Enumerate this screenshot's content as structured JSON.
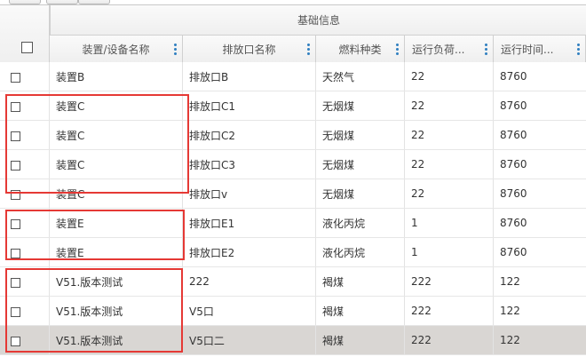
{
  "header": {
    "group_title": "基础信息",
    "columns": [
      "装置/设备名称",
      "排放口名称",
      "燃料种类",
      "运行负荷...",
      "运行时间..."
    ]
  },
  "rows": [
    {
      "device": "装置B",
      "outlet": "排放口B",
      "fuel": "天然气",
      "load": "22",
      "hours": "8760"
    },
    {
      "device": "装置C",
      "outlet": "排放口C1",
      "fuel": "无烟煤",
      "load": "22",
      "hours": "8760"
    },
    {
      "device": "装置C",
      "outlet": "排放口C2",
      "fuel": "无烟煤",
      "load": "22",
      "hours": "8760"
    },
    {
      "device": "装置C",
      "outlet": "排放口C3",
      "fuel": "无烟煤",
      "load": "22",
      "hours": "8760"
    },
    {
      "device": "装置C",
      "outlet": "排放口v",
      "fuel": "无烟煤",
      "load": "22",
      "hours": "8760"
    },
    {
      "device": "装置E",
      "outlet": "排放口E1",
      "fuel": "液化丙烷",
      "load": "1",
      "hours": "8760"
    },
    {
      "device": "装置E",
      "outlet": "排放口E2",
      "fuel": "液化丙烷",
      "load": "1",
      "hours": "8760"
    },
    {
      "device": "V51.版本测试",
      "outlet": "222",
      "fuel": "褐煤",
      "load": "222",
      "hours": "122"
    },
    {
      "device": "V51.版本测试",
      "outlet": "V5口",
      "fuel": "褐煤",
      "load": "222",
      "hours": "122"
    },
    {
      "device": "V51.版本测试",
      "outlet": "V5口二",
      "fuel": "褐煤",
      "load": "222",
      "hours": "122"
    }
  ],
  "colors": {
    "highlight_box": "#e53935",
    "selected_row": "#d9d6d3",
    "menu_dots": "#2f7fc0"
  }
}
